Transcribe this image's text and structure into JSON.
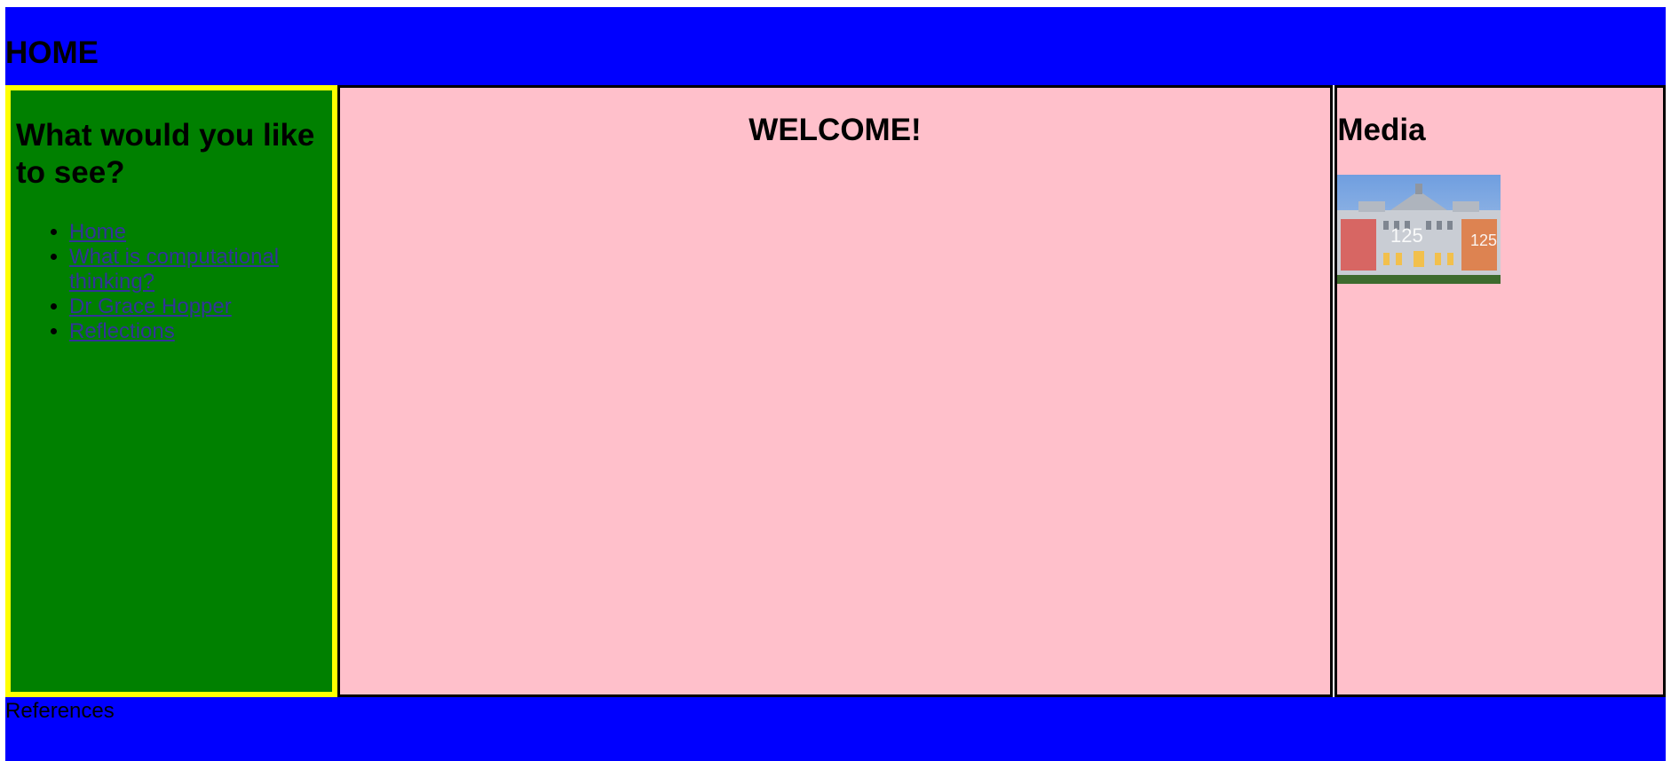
{
  "header": {
    "title": "HOME"
  },
  "nav": {
    "heading": "What would you like to see?",
    "links": [
      {
        "label": "Home"
      },
      {
        "label": "What is computational thinking?"
      },
      {
        "label": "Dr Grace Hopper"
      },
      {
        "label": "Reflections"
      }
    ]
  },
  "main": {
    "heading": "WELCOME!"
  },
  "aside": {
    "heading": "Media",
    "image": {
      "name": "university-building-photo",
      "text": "125"
    }
  },
  "footer": {
    "label": "References"
  },
  "colors": {
    "header_bg": "#0000ff",
    "nav_bg": "#008000",
    "nav_border": "#ffff00",
    "content_bg": "#ffc0cb",
    "link": "#333399"
  }
}
